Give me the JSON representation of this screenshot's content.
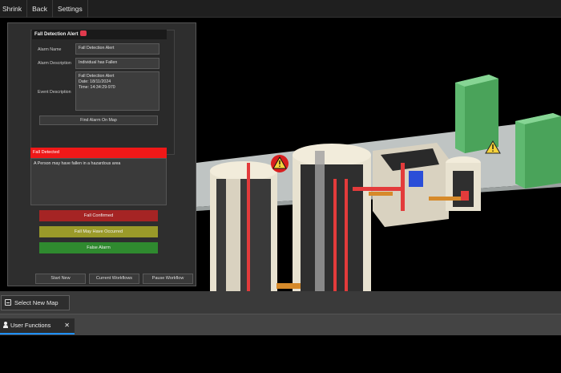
{
  "menu": {
    "items": [
      "Shrink",
      "Back",
      "Settings"
    ]
  },
  "alarm_panel": {
    "title": "Fall Detection Alert",
    "alarm_name_label": "Alarm Name",
    "alarm_name_value": "Fall Detection Alert",
    "alarm_description_label": "Alarm Description",
    "alarm_description_value": "Individual has Fallen",
    "event_description_label": "Event Description",
    "event_description_lines": [
      "Fall Detection Alert",
      "Date: 18/11/2024",
      "Time: 14:34:29-970"
    ],
    "find_alarm_button": "Find Alarm On Map",
    "fall_header": "Fall Detected",
    "fall_message": "A Person may have fallen in a hazardous area",
    "option_confirmed": "Fall Confirmed",
    "option_maybe": "Fall May Have Occurred",
    "option_false": "False Alarm",
    "start_new": "Start New",
    "current_workflows": "Current Workflows",
    "pause_workflow": "Pause Workflow"
  },
  "toolbar": {
    "select_map": "Select New Map",
    "select_map_icon": "map-select-icon"
  },
  "tabs": {
    "user_functions": "User Functions",
    "close_symbol": "✕",
    "user_icon": "user-icon"
  },
  "colors": {
    "alert_red": "#ef1818",
    "confirm_red": "#a52424",
    "maybe_yellow": "#9a9a29",
    "false_green": "#2f8a2f",
    "tab_accent": "#1e90ff"
  }
}
